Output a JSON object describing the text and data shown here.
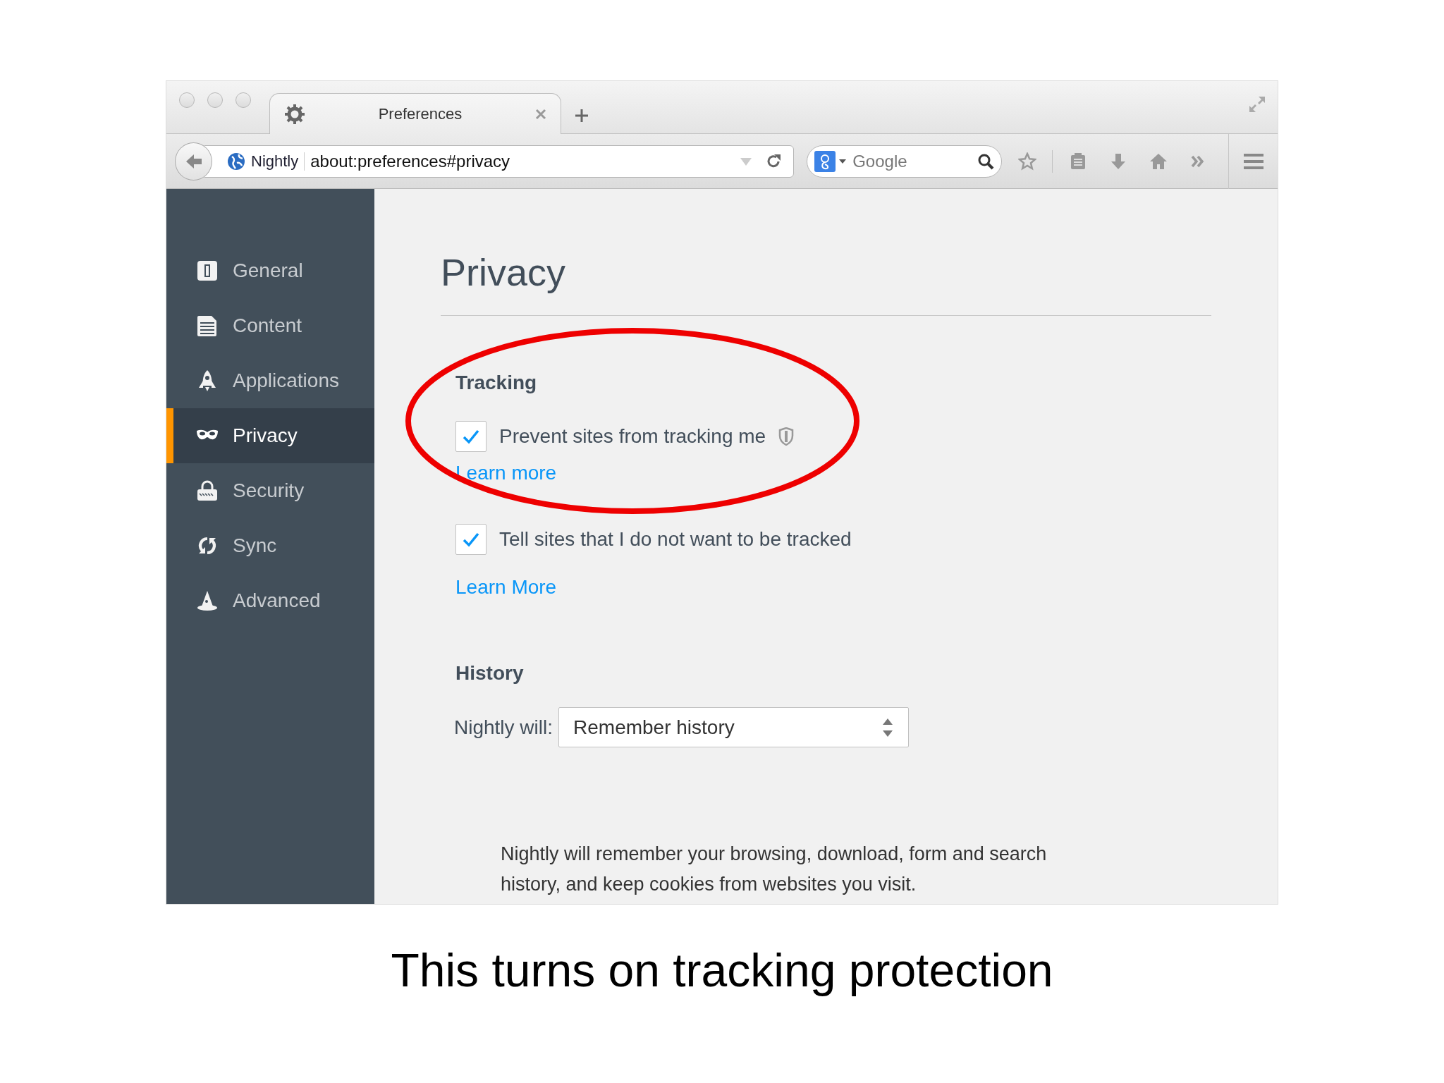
{
  "window": {
    "tab": {
      "title": "Preferences"
    },
    "toolbar": {
      "identity": "Nightly",
      "url": "about:preferences#privacy",
      "search_placeholder": "Google"
    }
  },
  "sidebar": {
    "items": [
      {
        "label": "General",
        "kind": "general",
        "selected": false
      },
      {
        "label": "Content",
        "kind": "content",
        "selected": false
      },
      {
        "label": "Applications",
        "kind": "applications",
        "selected": false
      },
      {
        "label": "Privacy",
        "kind": "privacy",
        "selected": true
      },
      {
        "label": "Security",
        "kind": "security",
        "selected": false
      },
      {
        "label": "Sync",
        "kind": "sync",
        "selected": false
      },
      {
        "label": "Advanced",
        "kind": "advanced",
        "selected": false
      }
    ]
  },
  "content": {
    "title": "Privacy",
    "sections": [
      {
        "kind": "checks",
        "heading": "Tracking",
        "highlighted": true,
        "options": [
          {
            "label": "Prevent sites from tracking me",
            "checked": true,
            "shield": true,
            "link": "Learn more"
          },
          {
            "label": "Tell sites that I do not want to be tracked",
            "checked": true,
            "shield": false,
            "link": "Learn More"
          }
        ]
      },
      {
        "kind": "history",
        "heading": "History",
        "label": "Nightly will:",
        "value": "Remember history",
        "description": "Nightly will remember your browsing, download, form and search history, and keep cookies from websites you visit."
      }
    ]
  },
  "caption": "This turns on tracking protection"
}
